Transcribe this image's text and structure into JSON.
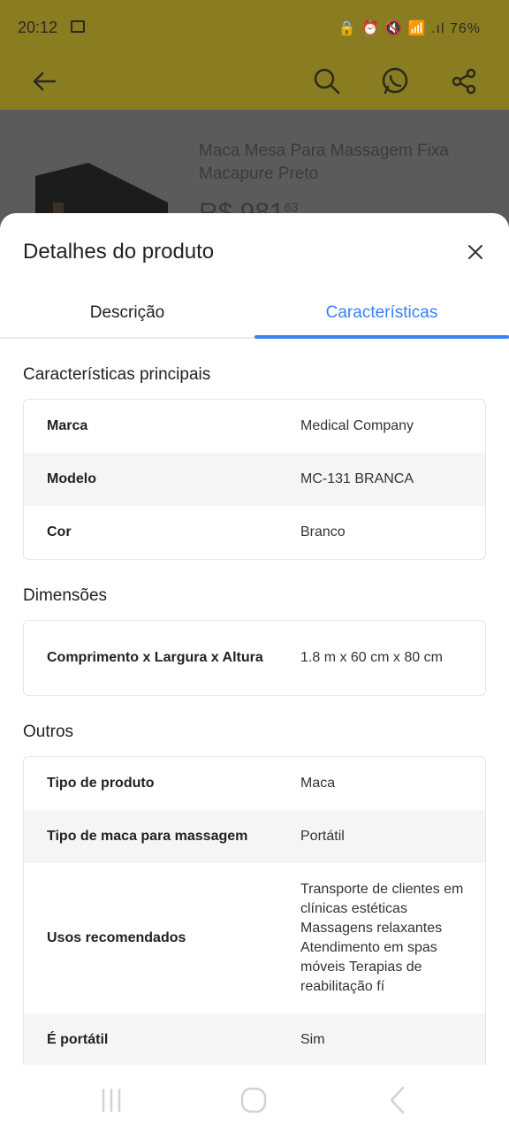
{
  "status_bar": {
    "time": "20:12",
    "indicators": "🔒 ⏰ 🔇 📶 .ıl 76%"
  },
  "app_bar": {
    "back_icon": "arrow-left",
    "search_icon": "search",
    "whatsapp_icon": "whatsapp",
    "share_icon": "share"
  },
  "product": {
    "title": "Maca Mesa Para Massagem Fixa Macapure Preto",
    "price_main": "R$ 981",
    "price_cents": "63"
  },
  "sheet": {
    "title": "Detalhes do produto",
    "tabs": [
      {
        "label": "Descrição",
        "active": false
      },
      {
        "label": "Características",
        "active": true
      }
    ],
    "sections": [
      {
        "title": "Características principais",
        "rows": [
          {
            "key": "Marca",
            "value": "Medical Company"
          },
          {
            "key": "Modelo",
            "value": "MC-131 BRANCA"
          },
          {
            "key": "Cor",
            "value": "Branco"
          }
        ]
      },
      {
        "title": "Dimensões",
        "rows": [
          {
            "key": "Comprimento x Largura x Altura",
            "value": "1.8 m x 60 cm x 80 cm"
          }
        ]
      },
      {
        "title": "Outros",
        "rows": [
          {
            "key": "Tipo de produto",
            "value": "Maca"
          },
          {
            "key": "Tipo de maca para massagem",
            "value": "Portátil"
          },
          {
            "key": "Usos recomendados",
            "value": "Transporte de clientes em clínicas estéticas Massagens relaxantes Atendimento em spas móveis Terapias de reabilitação fí"
          },
          {
            "key": "É portátil",
            "value": "Sim"
          }
        ]
      }
    ]
  },
  "colors": {
    "accent": "#3483fa",
    "app_bar_dimmed": "#8a7d21"
  }
}
